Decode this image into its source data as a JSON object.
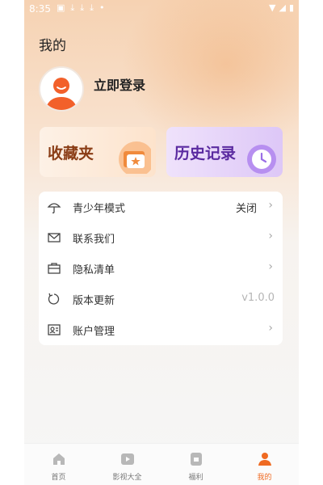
{
  "status_bar": {
    "time": "8:35"
  },
  "header": {
    "title": "我的",
    "login_label": "立即登录"
  },
  "cards": {
    "favorites_label": "收藏夹",
    "history_label": "历史记录"
  },
  "menu": {
    "items": [
      {
        "label": "青少年模式",
        "value": "关闭",
        "icon": "umbrella-icon"
      },
      {
        "label": "联系我们",
        "icon": "mail-icon"
      },
      {
        "label": "隐私清单",
        "icon": "briefcase-icon"
      },
      {
        "label": "版本更新",
        "value": "v1.0.0",
        "icon": "refresh-icon"
      },
      {
        "label": "账户管理",
        "icon": "id-card-icon"
      }
    ]
  },
  "tabbar": {
    "tabs": [
      {
        "label": "首页",
        "icon": "home-icon"
      },
      {
        "label": "影视大全",
        "icon": "play-icon"
      },
      {
        "label": "福利",
        "icon": "gift-icon"
      },
      {
        "label": "我的",
        "icon": "user-icon",
        "active": true
      }
    ]
  },
  "colors": {
    "accent": "#ef6a22",
    "favorites_text": "#8a3d16",
    "history_text": "#5a2aa0"
  }
}
